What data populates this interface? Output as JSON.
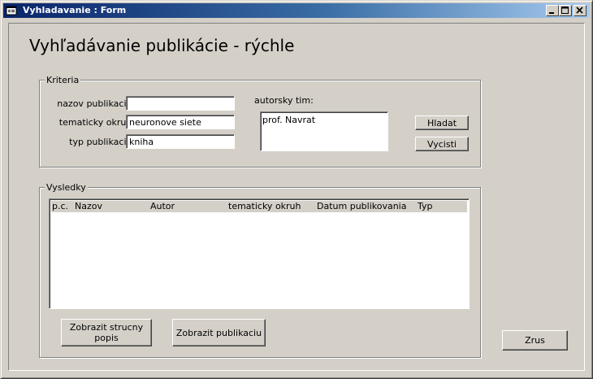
{
  "window": {
    "title": "Vyhladavanie : Form",
    "controls": {
      "minimize": "minimize-icon",
      "maximize": "maximize-icon",
      "close": "close-icon"
    }
  },
  "form": {
    "heading": "Vyhľadávanie publikácie - rýchle"
  },
  "criteria": {
    "group_label": "Kriteria",
    "nazov_label": "nazov publikacie:",
    "nazov_value": "",
    "okruh_label": "tematicky okruh:",
    "okruh_value": "neuronove siete",
    "typ_label": "typ publikacie:",
    "typ_value": "kniha",
    "autorsky_label": "autorsky tim:",
    "autorsky_items": [
      "prof. Navrat"
    ],
    "hladat_button": "Hladat",
    "vycisti_button": "Vycisti"
  },
  "results": {
    "group_label": "Vysledky",
    "columns": [
      "p.c.",
      "Nazov",
      "Autor",
      "tematicky okruh",
      "Datum publikovania",
      "Typ"
    ],
    "rows": [],
    "zobrazit_popis_button": "Zobrazit strucny popis",
    "zobrazit_publikaciu_button": "Zobrazit publikaciu"
  },
  "zrus_button": "Zrus",
  "colors": {
    "face": "#d4d0c8",
    "title_start": "#0a246a",
    "title_end": "#a6caf0"
  }
}
